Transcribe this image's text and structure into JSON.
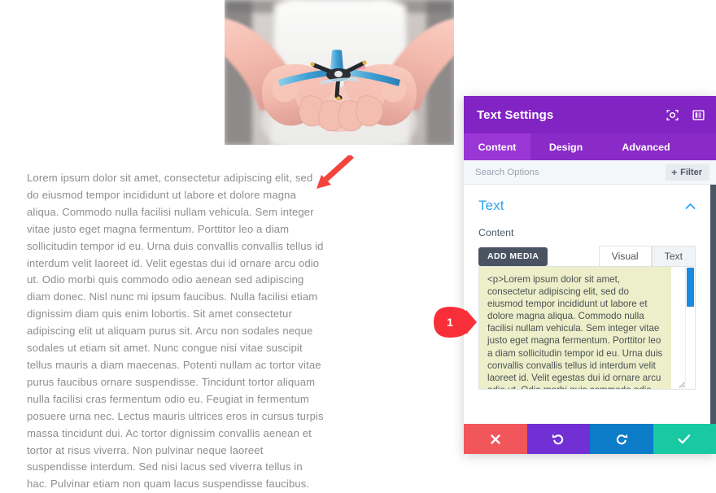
{
  "article": {
    "hero": {
      "alt": "child-hands-holding-toy-drone-photo"
    },
    "body_text": "Lorem ipsum dolor sit amet, consectetur adipiscing elit, sed do eiusmod tempor incididunt ut labore et dolore magna aliqua. Commodo nulla facilisi nullam vehicula. Sem integer vitae justo eget magna fermentum. Porttitor leo a diam sollicitudin tempor id eu. Urna duis convallis convallis tellus id interdum velit laoreet id. Velit egestas dui id ornare arcu odio ut. Odio morbi quis commodo odio aenean sed adipiscing diam donec. Nisl nunc mi ipsum faucibus. Nulla facilisi etiam dignissim diam quis enim lobortis. Sit amet consectetur adipiscing elit ut aliquam purus sit. Arcu non sodales neque sodales ut etiam sit amet. Nunc congue nisi vitae suscipit tellus mauris a diam maecenas. Potenti nullam ac tortor vitae purus faucibus ornare suspendisse. Tincidunt tortor aliquam nulla facilisi cras fermentum odio eu. Feugiat in fermentum posuere urna nec. Lectus mauris ultrices eros in cursus turpis massa tincidunt dui. Ac tortor dignissim convallis aenean et tortor at risus viverra. Non pulvinar neque laoreet suspendisse interdum. Sed nisi lacus sed viverra tellus in hac. Pulvinar etiam non quam lacus suspendisse faucibus."
  },
  "annotations": {
    "arrow": {
      "name": "red-pointer-arrow",
      "color": "#f4433c"
    },
    "pin": {
      "label": "1",
      "color": "#f82f38"
    }
  },
  "modal": {
    "title": "Text Settings",
    "titlebar_icons": [
      {
        "name": "focus-target-icon"
      },
      {
        "name": "layout-panel-icon"
      }
    ],
    "tabs": [
      {
        "label": "Content",
        "active": true
      },
      {
        "label": "Design",
        "active": false
      },
      {
        "label": "Advanced",
        "active": false
      }
    ],
    "search": {
      "placeholder": "Search Options",
      "value": ""
    },
    "filter_button": {
      "label": "Filter",
      "plus": "+"
    },
    "section": {
      "title": "Text",
      "collapsed": false
    },
    "content_field": {
      "label": "Content",
      "add_media_label": "ADD MEDIA",
      "mode_tabs": [
        {
          "label": "Visual",
          "active": false
        },
        {
          "label": "Text",
          "active": true
        }
      ],
      "textarea_value": "<p>Lorem ipsum dolor sit amet, consectetur adipiscing elit, sed do eiusmod tempor incididunt ut labore et dolore magna aliqua. Commodo nulla facilisi nullam vehicula. Sem integer vitae justo eget magna fermentum. Porttitor leo a diam sollicitudin tempor id eu. Urna duis convallis convallis tellus id interdum velit laoreet id. Velit egestas dui id ornare arcu odio ut. Odio morbi quis commodo odio aenean sed adipiscing diam"
    },
    "actions": [
      {
        "name": "cancel-button",
        "icon": "close-x-icon",
        "color": "#f0565a"
      },
      {
        "name": "undo-button",
        "icon": "undo-arrow-icon",
        "color": "#7130d4"
      },
      {
        "name": "redo-button",
        "icon": "redo-arrow-icon",
        "color": "#0c7cc8"
      },
      {
        "name": "save-button",
        "icon": "checkmark-icon",
        "color": "#19c9a4"
      }
    ]
  },
  "colors": {
    "modal_header": "#8223c4",
    "tab_strip": "#8a2bc8",
    "tab_active": "#9b36d6",
    "section_link": "#2ea3f2",
    "textarea_bg": "#ecefc9",
    "scroll_thumb": "#1a8ae0",
    "add_media_bg": "#495362"
  }
}
